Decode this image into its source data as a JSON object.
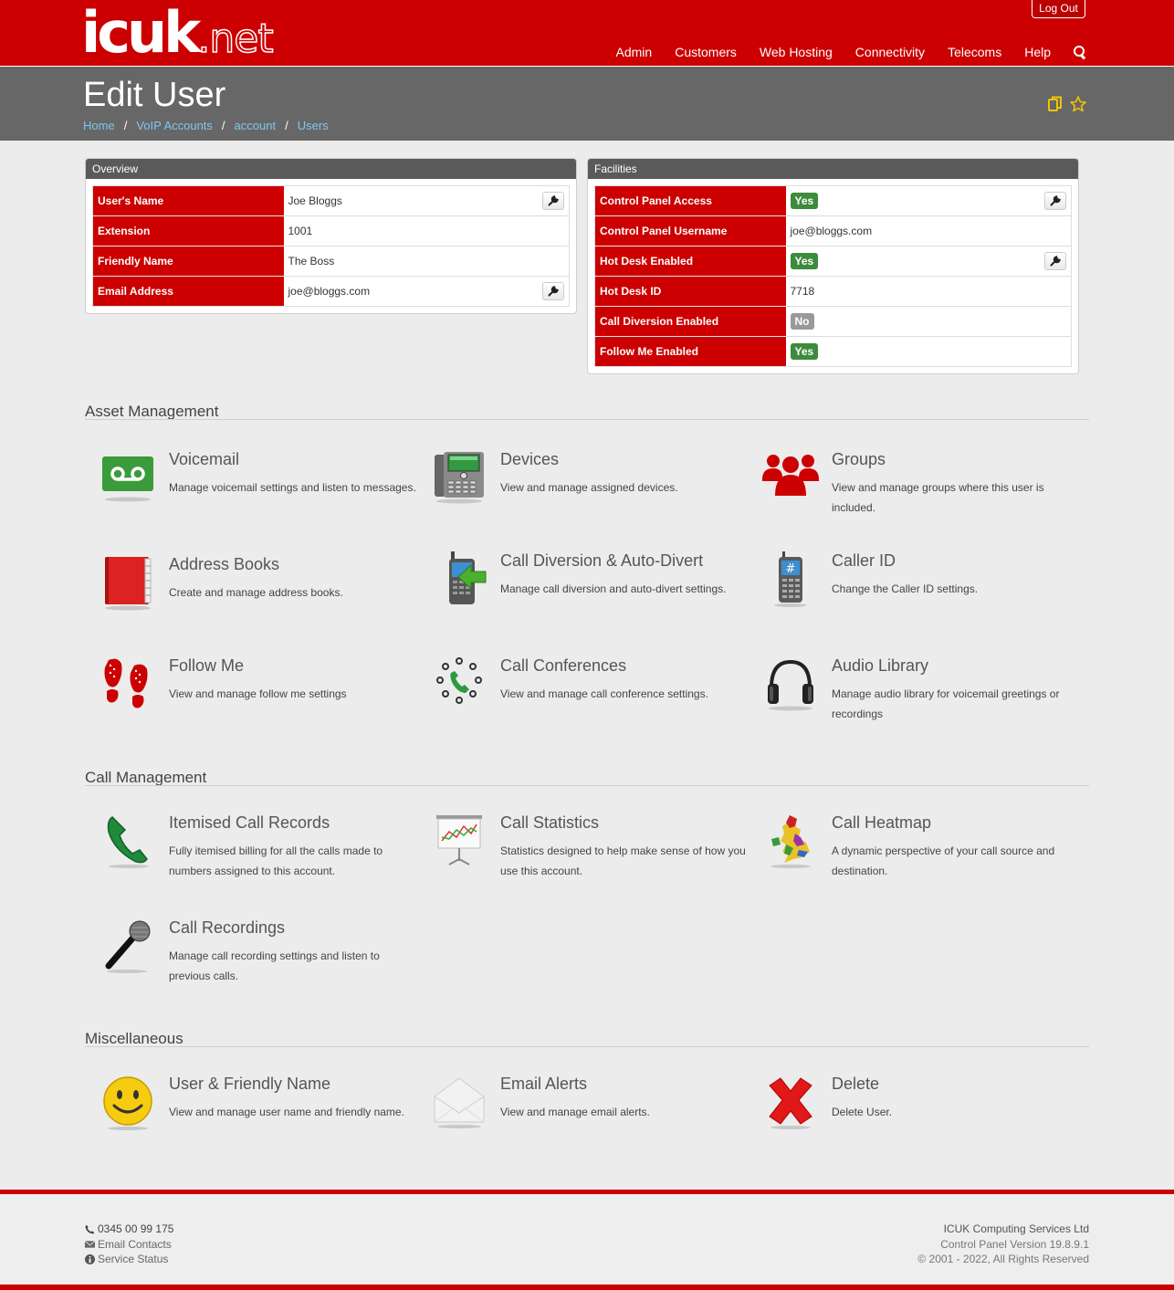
{
  "header": {
    "logo_main": "icuk",
    "logo_suffix": ".net",
    "logout_label": "Log Out",
    "nav": [
      "Admin",
      "Customers",
      "Web Hosting",
      "Connectivity",
      "Telecoms",
      "Help"
    ]
  },
  "page": {
    "title": "Edit User",
    "breadcrumb": [
      "Home",
      "VoIP Accounts",
      "account",
      "Users"
    ],
    "breadcrumb_sep": "/"
  },
  "overview": {
    "heading": "Overview",
    "rows": [
      {
        "label": "User's Name",
        "value": "Joe Bloggs",
        "editable": true
      },
      {
        "label": "Extension",
        "value": "1001",
        "editable": false
      },
      {
        "label": "Friendly Name",
        "value": "The Boss",
        "editable": false
      },
      {
        "label": "Email Address",
        "value": "joe@bloggs.com",
        "editable": true
      }
    ]
  },
  "facilities": {
    "heading": "Facilities",
    "rows": [
      {
        "label": "Control Panel Access",
        "value": "Yes",
        "badge": "yes",
        "editable": true
      },
      {
        "label": "Control Panel Username",
        "value": "joe@bloggs.com",
        "badge": null,
        "editable": false
      },
      {
        "label": "Hot Desk Enabled",
        "value": "Yes",
        "badge": "yes",
        "editable": true
      },
      {
        "label": "Hot Desk ID",
        "value": "7718",
        "badge": null,
        "editable": false
      },
      {
        "label": "Call Diversion Enabled",
        "value": "No",
        "badge": "no",
        "editable": false
      },
      {
        "label": "Follow Me Enabled",
        "value": "Yes",
        "badge": "yes",
        "editable": false
      }
    ]
  },
  "sections": {
    "asset": {
      "title": "Asset Management",
      "tiles": [
        {
          "title": "Voicemail",
          "desc": "Manage voicemail settings and listen to messages.",
          "icon": "voicemail-icon"
        },
        {
          "title": "Devices",
          "desc": "View and manage assigned devices.",
          "icon": "desk-phone-icon"
        },
        {
          "title": "Groups",
          "desc": "View and manage groups where this user is included.",
          "icon": "group-icon"
        },
        {
          "title": "Address Books",
          "desc": "Create and manage address books.",
          "icon": "address-book-icon"
        },
        {
          "title": "Call Diversion & Auto-Divert",
          "desc": "Manage call diversion and auto-divert settings.",
          "icon": "call-divert-icon"
        },
        {
          "title": "Caller ID",
          "desc": "Change the Caller ID settings.",
          "icon": "caller-id-phone-icon"
        },
        {
          "title": "Follow Me",
          "desc": "View and manage follow me settings",
          "icon": "footprints-icon"
        },
        {
          "title": "Call Conferences",
          "desc": "View and manage call conference settings.",
          "icon": "conference-icon"
        },
        {
          "title": "Audio Library",
          "desc": "Manage audio library for voicemail greetings or recordings",
          "icon": "headphones-icon"
        }
      ]
    },
    "call": {
      "title": "Call Management",
      "tiles": [
        {
          "title": "Itemised Call Records",
          "desc": "Fully itemised billing for all the calls made to numbers assigned to this account.",
          "icon": "phone-handset-icon"
        },
        {
          "title": "Call Statistics",
          "desc": "Statistics designed to help make sense of how you use this account.",
          "icon": "statistics-board-icon"
        },
        {
          "title": "Call Heatmap",
          "desc": "A dynamic perspective of your call source and destination.",
          "icon": "heatmap-icon"
        },
        {
          "title": "Call Recordings",
          "desc": "Manage call recording settings and listen to previous calls.",
          "icon": "microphone-icon"
        }
      ]
    },
    "misc": {
      "title": "Miscellaneous",
      "tiles": [
        {
          "title": "User & Friendly Name",
          "desc": "View and manage user name and friendly name.",
          "icon": "smiley-icon"
        },
        {
          "title": "Email Alerts",
          "desc": "View and manage email alerts.",
          "icon": "envelope-icon"
        },
        {
          "title": "Delete",
          "desc": "Delete User.",
          "icon": "red-x-icon"
        }
      ]
    }
  },
  "footer": {
    "phone": "0345 00 99 175",
    "email_contacts": "Email Contacts",
    "service_status": "Service Status",
    "company": "ICUK Computing Services Ltd",
    "version": "Control Panel Version 19.8.9.1",
    "copyright": "© 2001 - 2022, All Rights Reserved"
  },
  "colors": {
    "brand_red": "#cc0000",
    "title_bar": "#676767",
    "badge_yes": "#3d8b3d",
    "badge_no": "#999999",
    "link": "#7ec8ef"
  }
}
